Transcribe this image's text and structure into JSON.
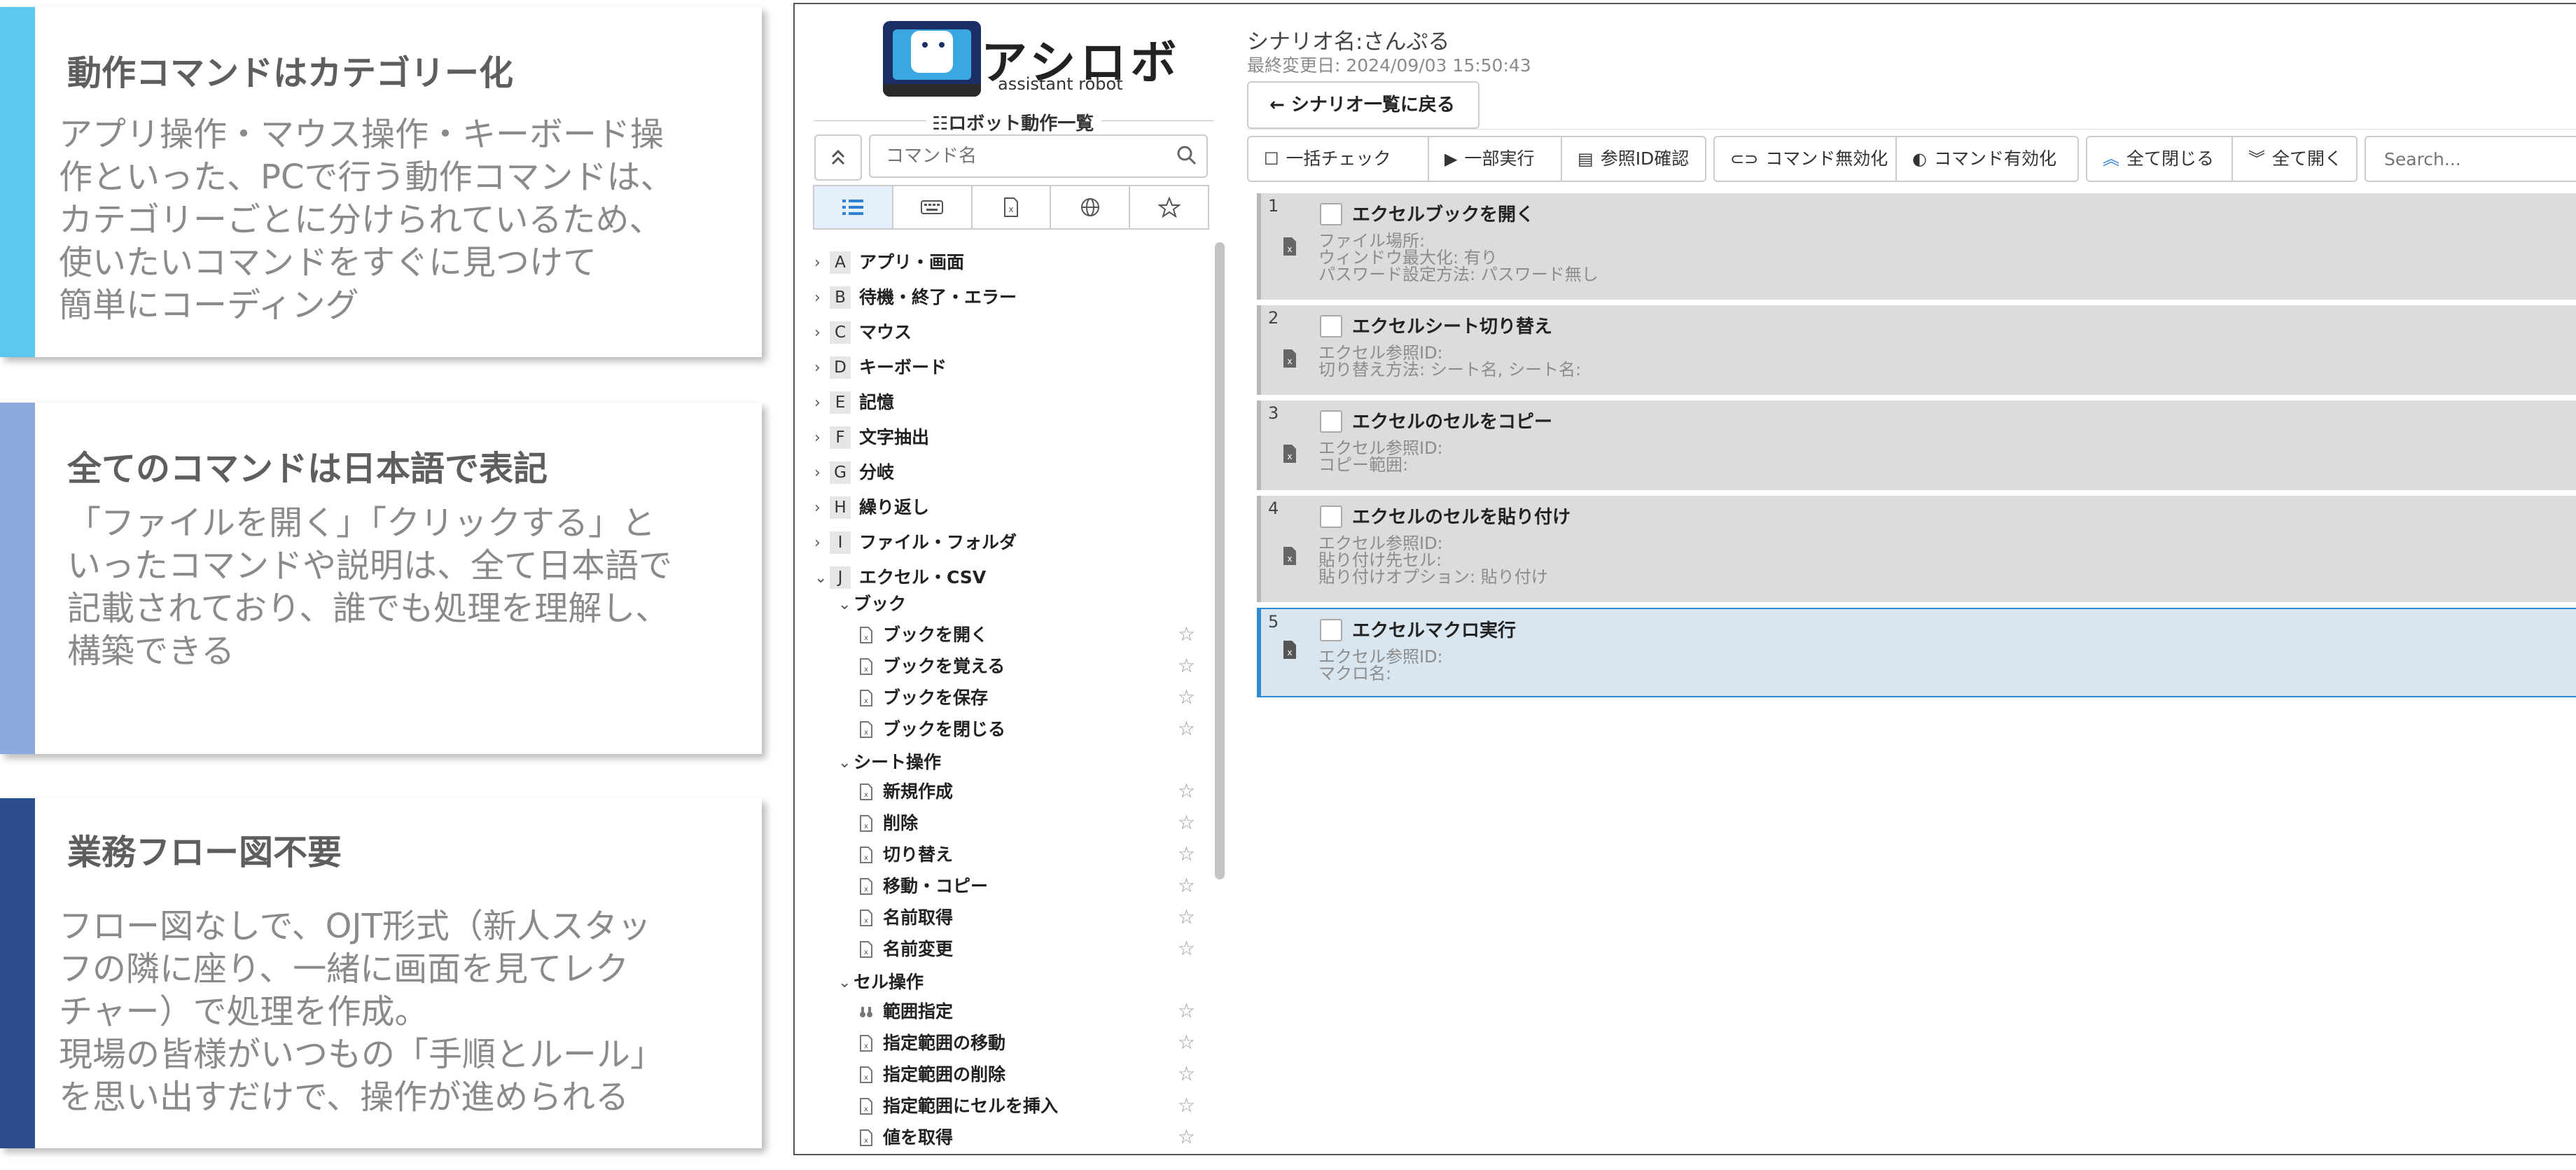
{
  "cards": [
    {
      "title": "動作コマンドはカテゴリー化",
      "body": "アプリ操作・マウス操作・キーボード操\n作といった、PCで行う動作コマンドは、\nカテゴリーごとに分けられているため、\n使いたいコマンドをすぐに見つけて\n簡単にコーディング",
      "accent": "#5bc8ef"
    },
    {
      "title": "全てのコマンドは日本語で表記",
      "body": "「ファイルを開く」「クリックする」と\nいったコマンドや説明は、全て日本語で\n記載されており、誰でも処理を理解し、\n構築できる",
      "accent": "#8da9de"
    },
    {
      "title": "業務フロー図不要",
      "body": "フロー図なしで、OJT形式（新人スタッ\nフの隣に座り、一緒に画面を見てレク\nチャー）で処理を作成。\n現場の皆様がいつもの「手順とルール」\nを思い出すだけで、操作が進められる",
      "accent": "#2d4e8e"
    }
  ],
  "sidebar": {
    "logo_title": "アシロボ",
    "logo_sub": "assistant robot",
    "list_heading": "☷ロボット動作一覧",
    "search_placeholder": "コマンド名",
    "categories": [
      {
        "letter": "A",
        "name": "アプリ・画面"
      },
      {
        "letter": "B",
        "name": "待機・終了・エラー"
      },
      {
        "letter": "C",
        "name": "マウス"
      },
      {
        "letter": "D",
        "name": "キーボード"
      },
      {
        "letter": "E",
        "name": "記憶"
      },
      {
        "letter": "F",
        "name": "文字抽出"
      },
      {
        "letter": "G",
        "name": "分岐"
      },
      {
        "letter": "H",
        "name": "繰り返し"
      },
      {
        "letter": "I",
        "name": "ファイル・フォルダ"
      },
      {
        "letter": "J",
        "name": "エクセル・CSV"
      }
    ],
    "groups": [
      {
        "name": "ブック",
        "items": [
          "ブックを開く",
          "ブックを覚える",
          "ブックを保存",
          "ブックを閉じる"
        ]
      },
      {
        "name": "シート操作",
        "items": [
          "新規作成",
          "削除",
          "切り替え",
          "移動・コピー",
          "名前取得",
          "名前変更"
        ]
      },
      {
        "name": "セル操作",
        "items": [
          "範囲指定",
          "指定範囲の移動",
          "指定範囲の削除",
          "指定範囲にセルを挿入",
          "値を取得"
        ]
      }
    ]
  },
  "main": {
    "scenario_name": "シナリオ名:さんぷる",
    "last_modified": "最終変更日: 2024/09/03 15:50:43",
    "back_label": "シナリオ一覧に戻る",
    "toolbar": {
      "bulk_check": "一括チェック",
      "partial_run": "一部実行",
      "ref_id_check": "参照ID確認",
      "disable_cmd": "コマンド無効化",
      "enable_cmd": "コマンド有効化",
      "collapse_all": "全て閉じる",
      "expand_all": "全て開く",
      "search_placeholder": "Search..."
    },
    "commands": [
      {
        "num": "1",
        "title": "エクセルブックを開く",
        "params": [
          "ファイル場所:",
          "ウィンドウ最大化: 有り",
          "パスワード設定方法: パスワード無し"
        ]
      },
      {
        "num": "2",
        "title": "エクセルシート切り替え",
        "params": [
          "エクセル参照ID:",
          "切り替え方法: シート名, シート名:"
        ]
      },
      {
        "num": "3",
        "title": "エクセルのセルをコピー",
        "params": [
          "エクセル参照ID:",
          "コピー範囲:"
        ]
      },
      {
        "num": "4",
        "title": "エクセルのセルを貼り付け",
        "params": [
          "エクセル参照ID:",
          "貼り付け先セル:",
          "貼り付けオプション: 貼り付け"
        ]
      },
      {
        "num": "5",
        "title": "エクセルマクロ実行",
        "params": [
          "エクセル参照ID:",
          "マクロ名:"
        ]
      }
    ]
  }
}
